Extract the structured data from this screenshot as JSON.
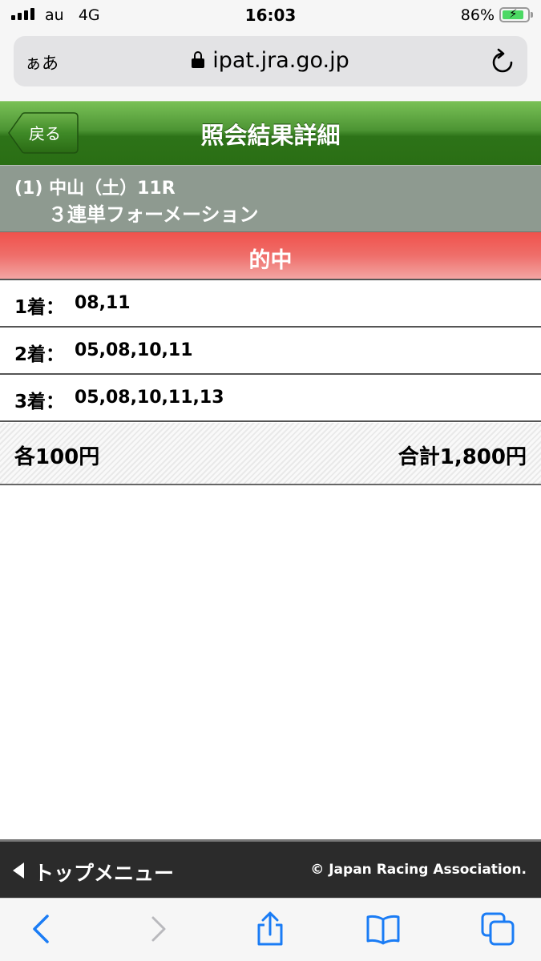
{
  "status_bar": {
    "carrier": "au",
    "network": "4G",
    "time": "16:03",
    "battery_percent": "86%",
    "battery_level": 0.86,
    "battery_charging": true
  },
  "browser": {
    "text_size_label": "ぁあ",
    "url": "ipat.jra.go.jp",
    "reload_icon": "reload-icon",
    "toolbar_icons": [
      "back-arrow-icon",
      "forward-arrow-icon",
      "share-icon",
      "bookmarks-icon",
      "tabs-icon"
    ]
  },
  "header": {
    "back_label": "戻る",
    "title": "照会結果詳細",
    "accent_color": "#3d8526"
  },
  "race": {
    "line1": "(1) 中山（土）11R",
    "line2": "３連単フォーメーション"
  },
  "result": {
    "label": "的中",
    "color": "#ef5a55"
  },
  "placings": [
    {
      "label": "1着：",
      "numbers": "08,11"
    },
    {
      "label": "2着：",
      "numbers": "05,08,10,11"
    },
    {
      "label": "3着：",
      "numbers": "05,08,10,11,13"
    }
  ],
  "summary": {
    "unit_price": "各100円",
    "total": "合計1,800円"
  },
  "footer": {
    "menu_label": "トップメニュー",
    "copyright": "© Japan Racing Association."
  }
}
